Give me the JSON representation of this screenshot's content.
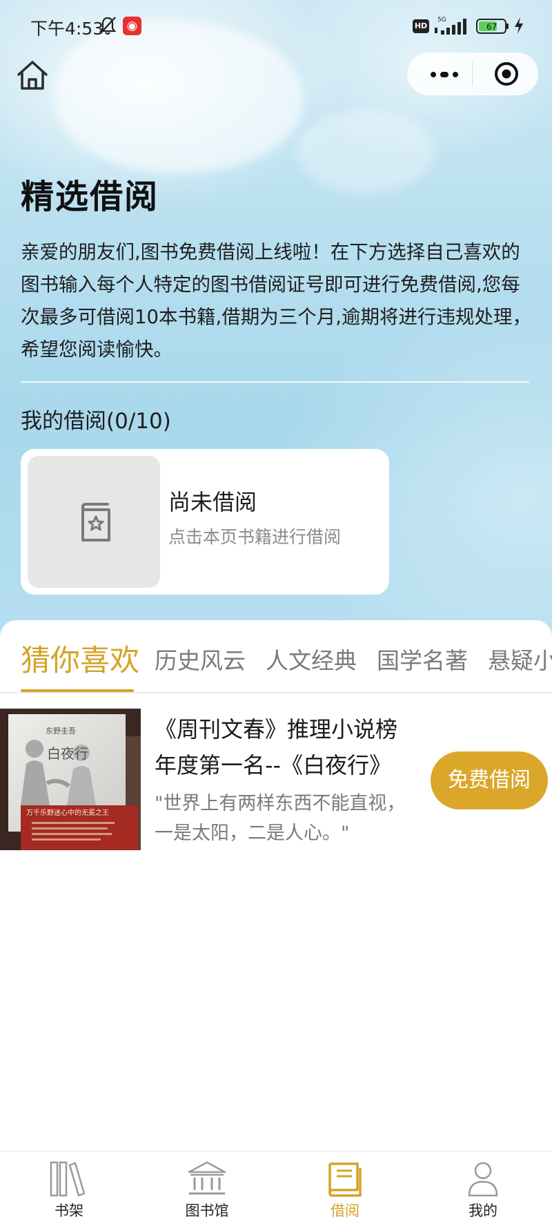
{
  "status_bar": {
    "time": "下午4:53",
    "hd": "HD",
    "network": "5G",
    "battery": "67"
  },
  "header": {
    "home_icon": "home-icon",
    "more_icon": "more-dots-icon",
    "close_icon": "target-icon"
  },
  "page": {
    "title": "精选借阅",
    "intro": "亲爱的朋友们,图书免费借阅上线啦！在下方选择自己喜欢的图书输入每个人特定的图书借阅证号即可进行免费借阅,您每次最多可借阅10本书籍,借期为三个月,逾期将进行违规处理，希望您阅读愉快。"
  },
  "my_borrow": {
    "title": "我的借阅(0/10)",
    "empty_title": "尚未借阅",
    "empty_subtitle": "点击本页书籍进行借阅"
  },
  "tabs": [
    {
      "label": "猜你喜欢",
      "active": true
    },
    {
      "label": "历史风云",
      "active": false
    },
    {
      "label": "人文经典",
      "active": false
    },
    {
      "label": "国学名著",
      "active": false
    },
    {
      "label": "悬疑小说",
      "active": false
    }
  ],
  "books": [
    {
      "title": "《周刊文春》推理小说榜年度第一名--《白夜行》",
      "quote": "\"世界上有两样东西不能直视，一是太阳，二是人心。\"",
      "button": "免费借阅",
      "cover_author": "东野圭吾",
      "cover_title": "白夜行",
      "cover_banner": "万千乐野迷心中的无冕之王"
    }
  ],
  "tabbar": [
    {
      "label": "书架",
      "icon": "bookshelf-icon",
      "active": false
    },
    {
      "label": "图书馆",
      "icon": "library-icon",
      "active": false
    },
    {
      "label": "借阅",
      "icon": "book-icon",
      "active": true
    },
    {
      "label": "我的",
      "icon": "person-icon",
      "active": false
    }
  ],
  "colors": {
    "accent": "#d4a326",
    "hero_sky": "#b9e0f0"
  }
}
